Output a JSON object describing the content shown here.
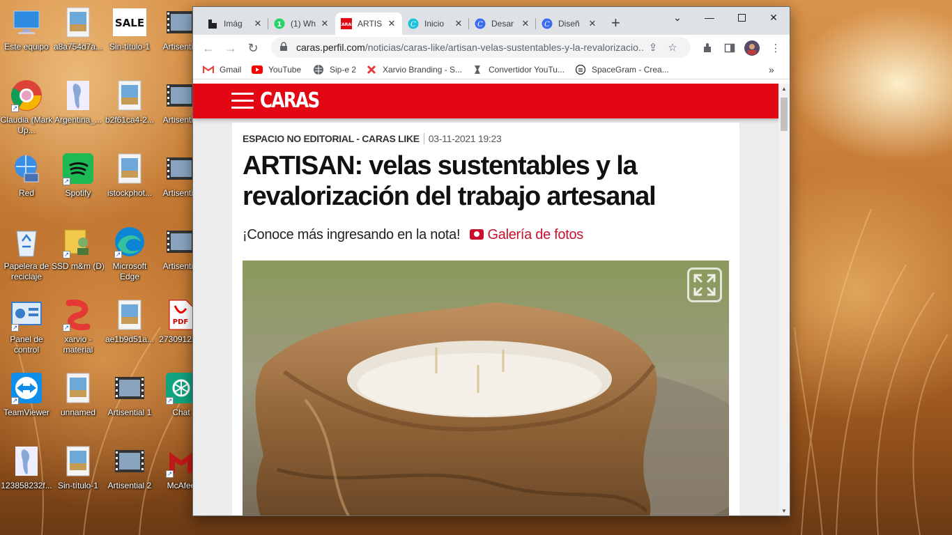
{
  "desktop": {
    "icons": [
      {
        "label": "Este equipo",
        "icon": "computer-icon"
      },
      {
        "label": "a8a754d7a...",
        "icon": "image-file-icon"
      },
      {
        "label": "Sin-título-1",
        "icon": "sale-image-icon"
      },
      {
        "label": "Artisential",
        "icon": "video-file-icon"
      },
      {
        "label": "Claudia (Mark Up...",
        "icon": "chrome-icon"
      },
      {
        "label": "Argentina_...",
        "icon": "map-file-icon"
      },
      {
        "label": "b2f61ca4-2...",
        "icon": "image-file-icon"
      },
      {
        "label": "Artisential",
        "icon": "video-file-icon"
      },
      {
        "label": "Red",
        "icon": "network-icon"
      },
      {
        "label": "Spotify",
        "icon": "spotify-icon"
      },
      {
        "label": "istockphot...",
        "icon": "image-file-icon"
      },
      {
        "label": "Artisential",
        "icon": "video-file-icon"
      },
      {
        "label": "Papelera de reciclaje",
        "icon": "recycle-bin-icon"
      },
      {
        "label": "SSD m&m (D)",
        "icon": "drive-icon"
      },
      {
        "label": "Microsoft Edge",
        "icon": "edge-icon"
      },
      {
        "label": "Artisential",
        "icon": "video-file-icon"
      },
      {
        "label": "Panel de control",
        "icon": "control-panel-icon"
      },
      {
        "label": "xarvio - material",
        "icon": "xarvio-icon"
      },
      {
        "label": "ae1b9d51a...",
        "icon": "image-file-icon"
      },
      {
        "label": "27309122...",
        "icon": "pdf-icon"
      },
      {
        "label": "TeamViewer",
        "icon": "teamviewer-icon"
      },
      {
        "label": "unnamed",
        "icon": "image-file-icon"
      },
      {
        "label": "Artisential 1",
        "icon": "video-file-icon"
      },
      {
        "label": "Chat",
        "icon": "chatgpt-icon"
      },
      {
        "label": "123858232f...",
        "icon": "map-file-icon"
      },
      {
        "label": "Sin-título-1",
        "icon": "image-file-icon"
      },
      {
        "label": "Artisential 2",
        "icon": "video-file-icon"
      },
      {
        "label": "McAfee",
        "icon": "mcafee-icon"
      }
    ]
  },
  "browser": {
    "tabs": [
      {
        "title": "Imág",
        "icon": "image-tab-icon"
      },
      {
        "title": "(1) Wh",
        "icon": "whatsapp-icon"
      },
      {
        "title": "ARTIS",
        "icon": "caras-icon"
      },
      {
        "title": "Inicio",
        "icon": "canva-icon"
      },
      {
        "title": "Desar",
        "icon": "canva-icon"
      },
      {
        "title": "Diseñ",
        "icon": "canva-icon"
      }
    ],
    "url_domain": "caras.perfil.com",
    "url_path": "/noticias/caras-like/artisan-velas-sustentables-y-la-revalorizacio...",
    "bookmarks": [
      {
        "label": "Gmail",
        "icon": "gmail-icon",
        "color": "#ea4335"
      },
      {
        "label": "YouTube",
        "icon": "youtube-icon",
        "color": "#ff0000"
      },
      {
        "label": "Sip-e 2",
        "icon": "globe-icon",
        "color": "#5f6368"
      },
      {
        "label": "Xarvio Branding - S...",
        "icon": "xarvio-icon",
        "color": "#e53935"
      },
      {
        "label": "Convertidor YouTu...",
        "icon": "converter-icon",
        "color": "#5f6368"
      },
      {
        "label": "SpaceGram - Crea...",
        "icon": "spacegram-icon",
        "color": "#5f6368"
      }
    ],
    "overflow_label": "»"
  },
  "page": {
    "logo": "CARAS",
    "accent": "#e30613",
    "kicker": "ESPACIO NO EDITORIAL - CARAS LIKE",
    "date": "03-11-2021 19:23",
    "title": "ARTISAN: velas sustentables y la revalorización del trabajo artesanal",
    "lead": "¡Conoce más ingresando en la nota!",
    "gallery_label": "Galería de fotos"
  }
}
